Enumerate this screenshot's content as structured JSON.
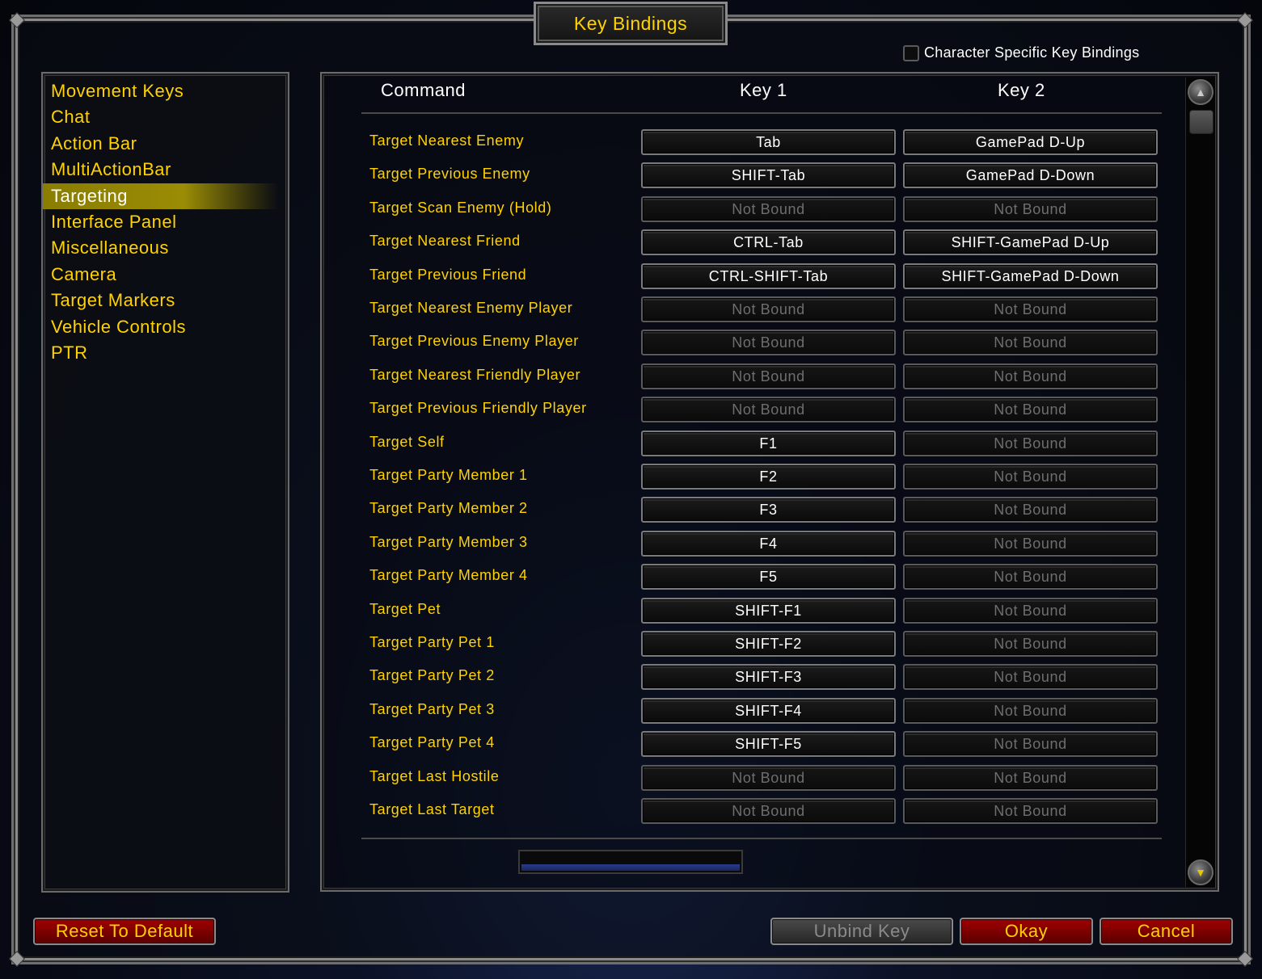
{
  "window": {
    "title": "Key Bindings"
  },
  "character_specific": {
    "label": "Character Specific Key Bindings",
    "checked": false
  },
  "categories": {
    "items": [
      {
        "label": "Movement Keys"
      },
      {
        "label": "Chat"
      },
      {
        "label": "Action Bar"
      },
      {
        "label": "MultiActionBar"
      },
      {
        "label": "Targeting",
        "selected": true
      },
      {
        "label": "Interface Panel"
      },
      {
        "label": "Miscellaneous"
      },
      {
        "label": "Camera"
      },
      {
        "label": "Target Markers"
      },
      {
        "label": "Vehicle Controls"
      },
      {
        "label": "PTR"
      }
    ]
  },
  "headers": {
    "command": "Command",
    "key1": "Key 1",
    "key2": "Key 2"
  },
  "bindings": {
    "rows": [
      {
        "command": "Target Nearest Enemy",
        "key1": "Tab",
        "key2": "GamePad D-Up"
      },
      {
        "command": "Target Previous Enemy",
        "key1": "SHIFT-Tab",
        "key2": "GamePad D-Down"
      },
      {
        "command": "Target Scan Enemy (Hold)",
        "key1": "Not Bound",
        "key2": "Not Bound"
      },
      {
        "command": "Target Nearest Friend",
        "key1": "CTRL-Tab",
        "key2": "SHIFT-GamePad D-Up"
      },
      {
        "command": "Target Previous Friend",
        "key1": "CTRL-SHIFT-Tab",
        "key2": "SHIFT-GamePad D-Down"
      },
      {
        "command": "Target Nearest Enemy Player",
        "key1": "Not Bound",
        "key2": "Not Bound"
      },
      {
        "command": "Target Previous Enemy Player",
        "key1": "Not Bound",
        "key2": "Not Bound"
      },
      {
        "command": "Target Nearest Friendly Player",
        "key1": "Not Bound",
        "key2": "Not Bound"
      },
      {
        "command": "Target Previous Friendly Player",
        "key1": "Not Bound",
        "key2": "Not Bound"
      },
      {
        "command": "Target Self",
        "key1": "F1",
        "key2": "Not Bound"
      },
      {
        "command": "Target Party Member 1",
        "key1": "F2",
        "key2": "Not Bound"
      },
      {
        "command": "Target Party Member 2",
        "key1": "F3",
        "key2": "Not Bound"
      },
      {
        "command": "Target Party Member 3",
        "key1": "F4",
        "key2": "Not Bound"
      },
      {
        "command": "Target Party Member 4",
        "key1": "F5",
        "key2": "Not Bound"
      },
      {
        "command": "Target Pet",
        "key1": "SHIFT-F1",
        "key2": "Not Bound"
      },
      {
        "command": "Target Party Pet 1",
        "key1": "SHIFT-F2",
        "key2": "Not Bound"
      },
      {
        "command": "Target Party Pet 2",
        "key1": "SHIFT-F3",
        "key2": "Not Bound"
      },
      {
        "command": "Target Party Pet 3",
        "key1": "SHIFT-F4",
        "key2": "Not Bound"
      },
      {
        "command": "Target Party Pet 4",
        "key1": "SHIFT-F5",
        "key2": "Not Bound"
      },
      {
        "command": "Target Last Hostile",
        "key1": "Not Bound",
        "key2": "Not Bound"
      },
      {
        "command": "Target Last Target",
        "key1": "Not Bound",
        "key2": "Not Bound"
      }
    ]
  },
  "buttons": {
    "reset": "Reset To Default",
    "unbind": "Unbind Key",
    "okay": "Okay",
    "cancel": "Cancel"
  },
  "icons": {
    "scroll_up": "scroll-up-arrow-icon",
    "scroll_down": "scroll-down-arrow-icon"
  },
  "colors": {
    "accent_gold": "#ffd200",
    "selected_highlight": "#8a7d00",
    "button_red": "#a00000",
    "unbound_gray": "#6e6e6e"
  }
}
